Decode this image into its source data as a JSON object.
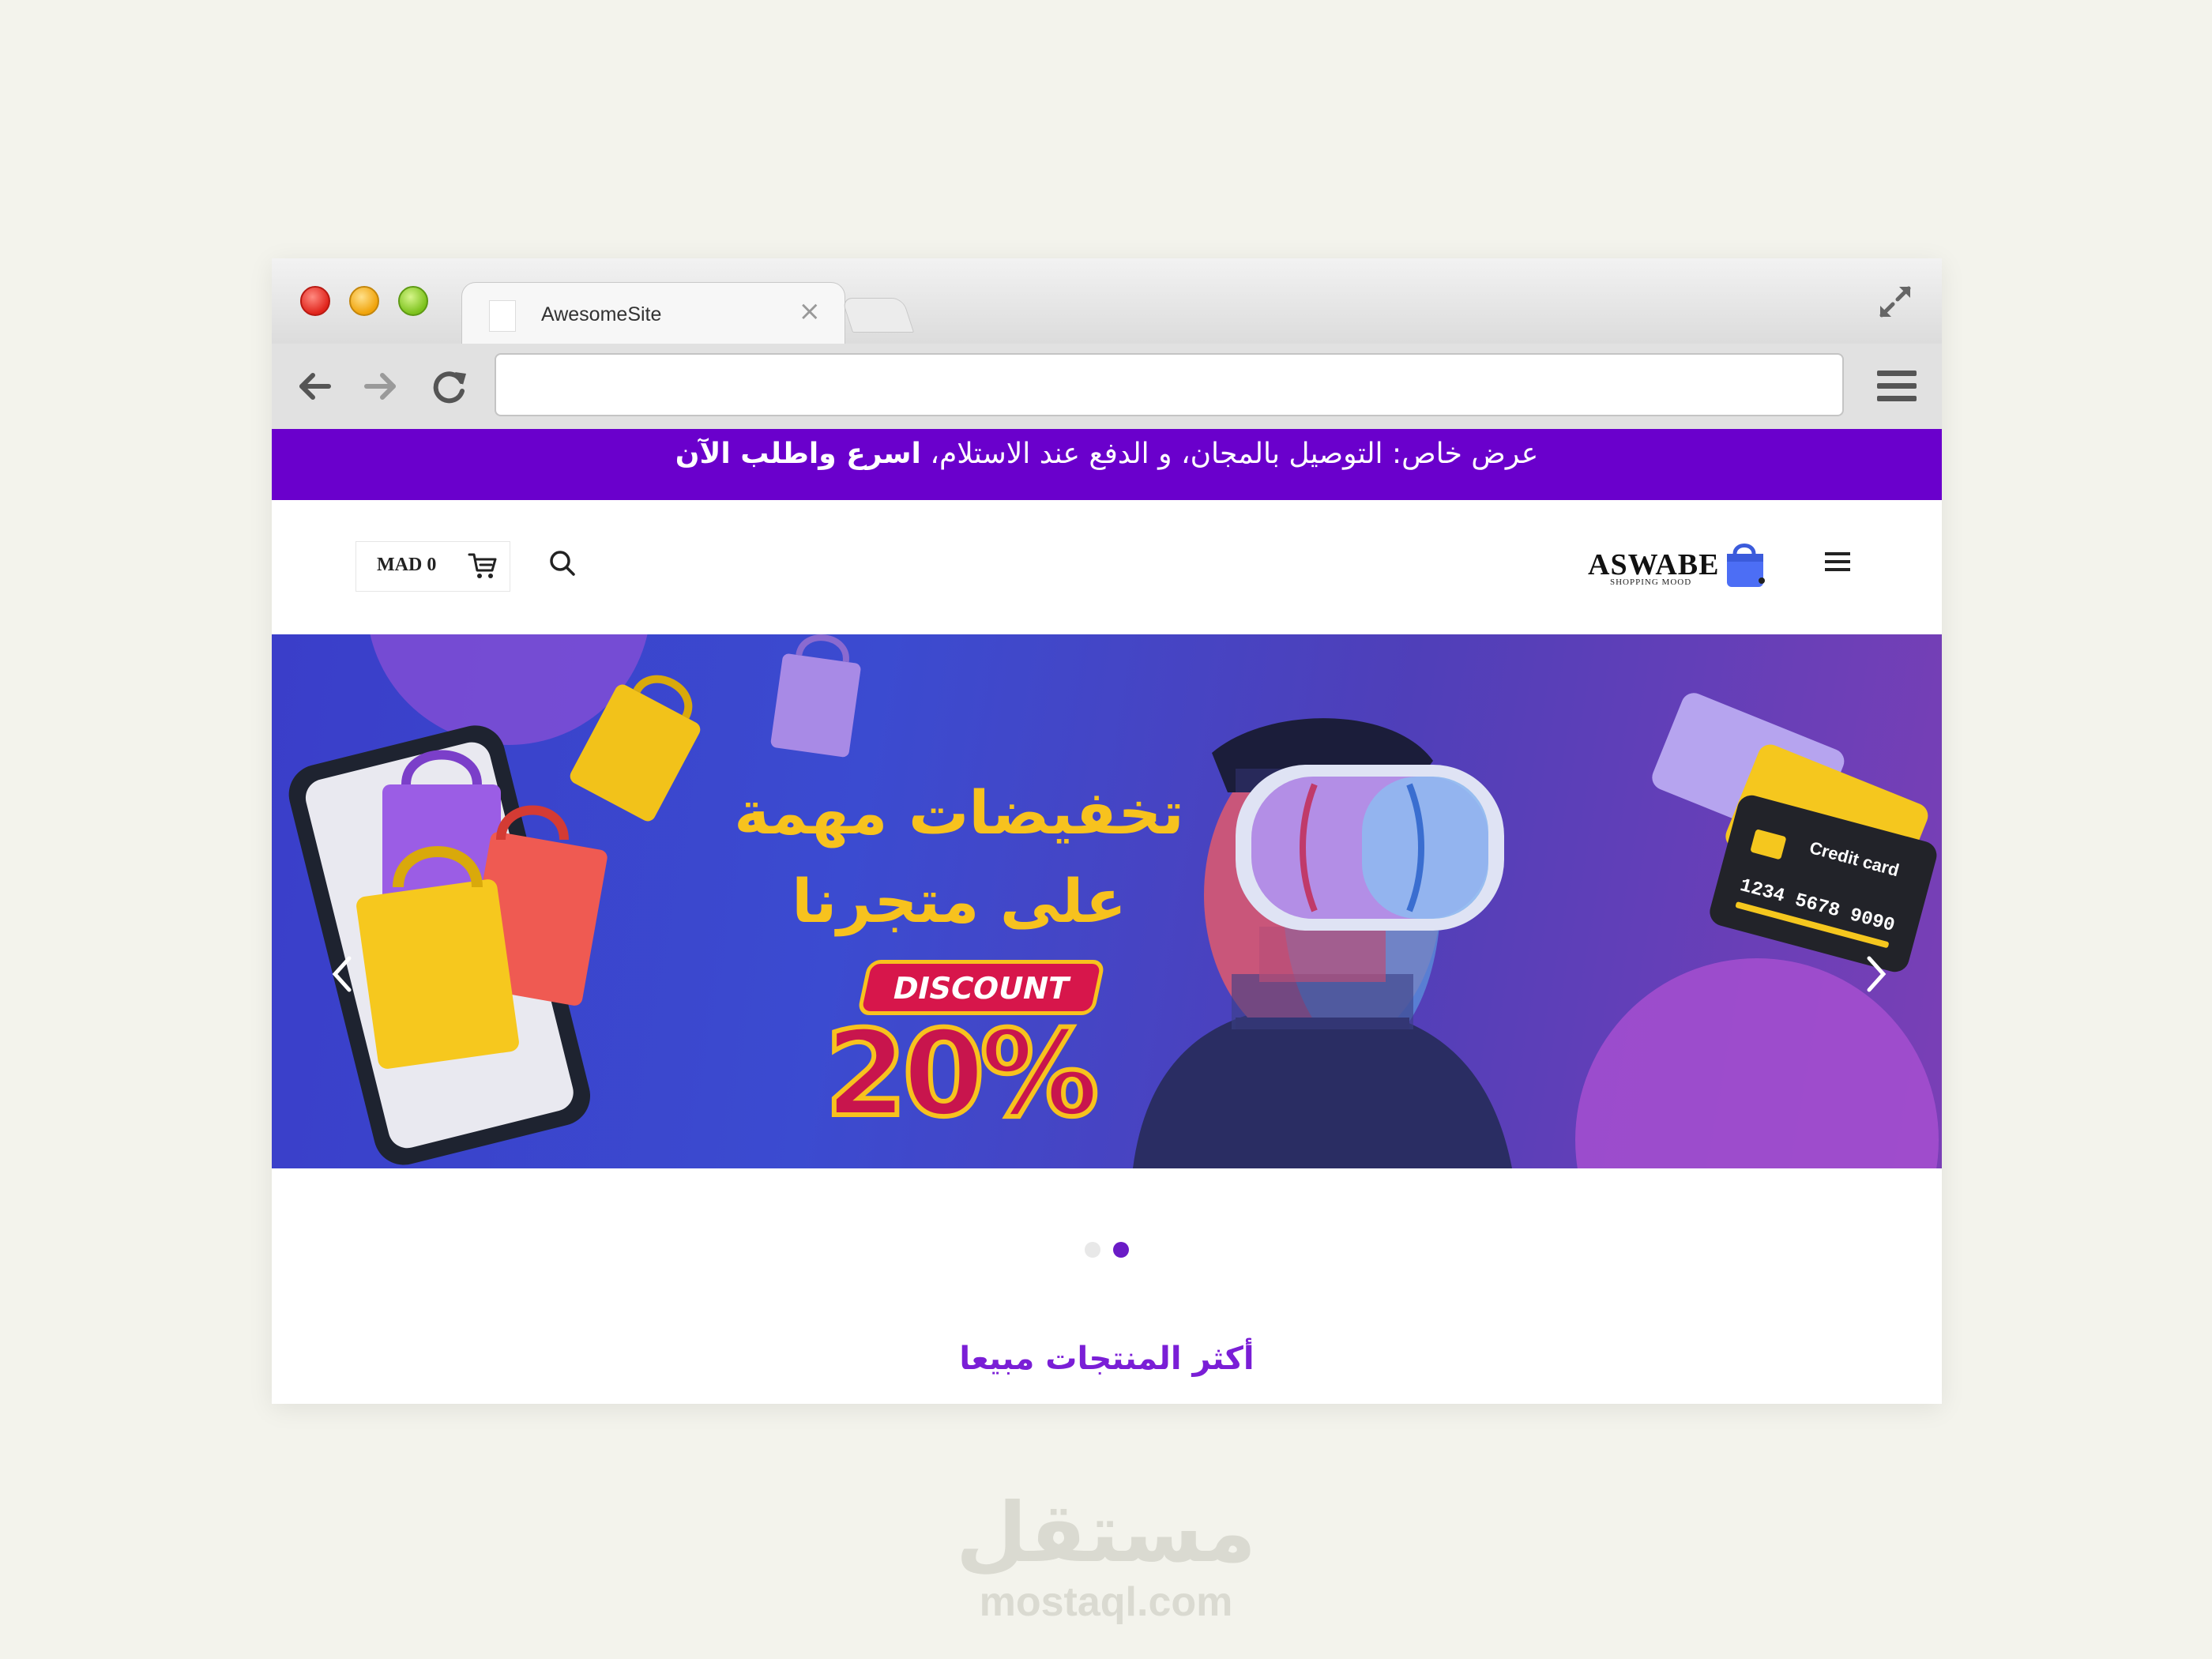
{
  "browser": {
    "tab_title": "AwesomeSite",
    "tab_close": "×",
    "url": ""
  },
  "announcement": {
    "text": "عرض خاص: التوصيل بالمجان، و الدفع عند الاستلام،",
    "bold": "اسرع واطلب الآن"
  },
  "header": {
    "cart_total": "MAD 0",
    "logo_text": "ASWABE",
    "logo_tagline": "SHOPPING MOOD"
  },
  "hero": {
    "title_line1": "تخفيضات مهمة",
    "title_line2": "على متجرنا",
    "discount_label": "DISCOUNT",
    "discount_value": "20%",
    "card_label": "Credit card",
    "card_number": "1234 5678 9090"
  },
  "slider": {
    "slides": 2,
    "active": 2
  },
  "section": {
    "title": "أكثر المنتجات مبيعا"
  },
  "watermark": {
    "ar": "مستقل",
    "en": "mostaql.com"
  },
  "colors": {
    "accent": "#6a00cc",
    "hero_text": "#f7c21e",
    "discount": "#d7164b"
  }
}
